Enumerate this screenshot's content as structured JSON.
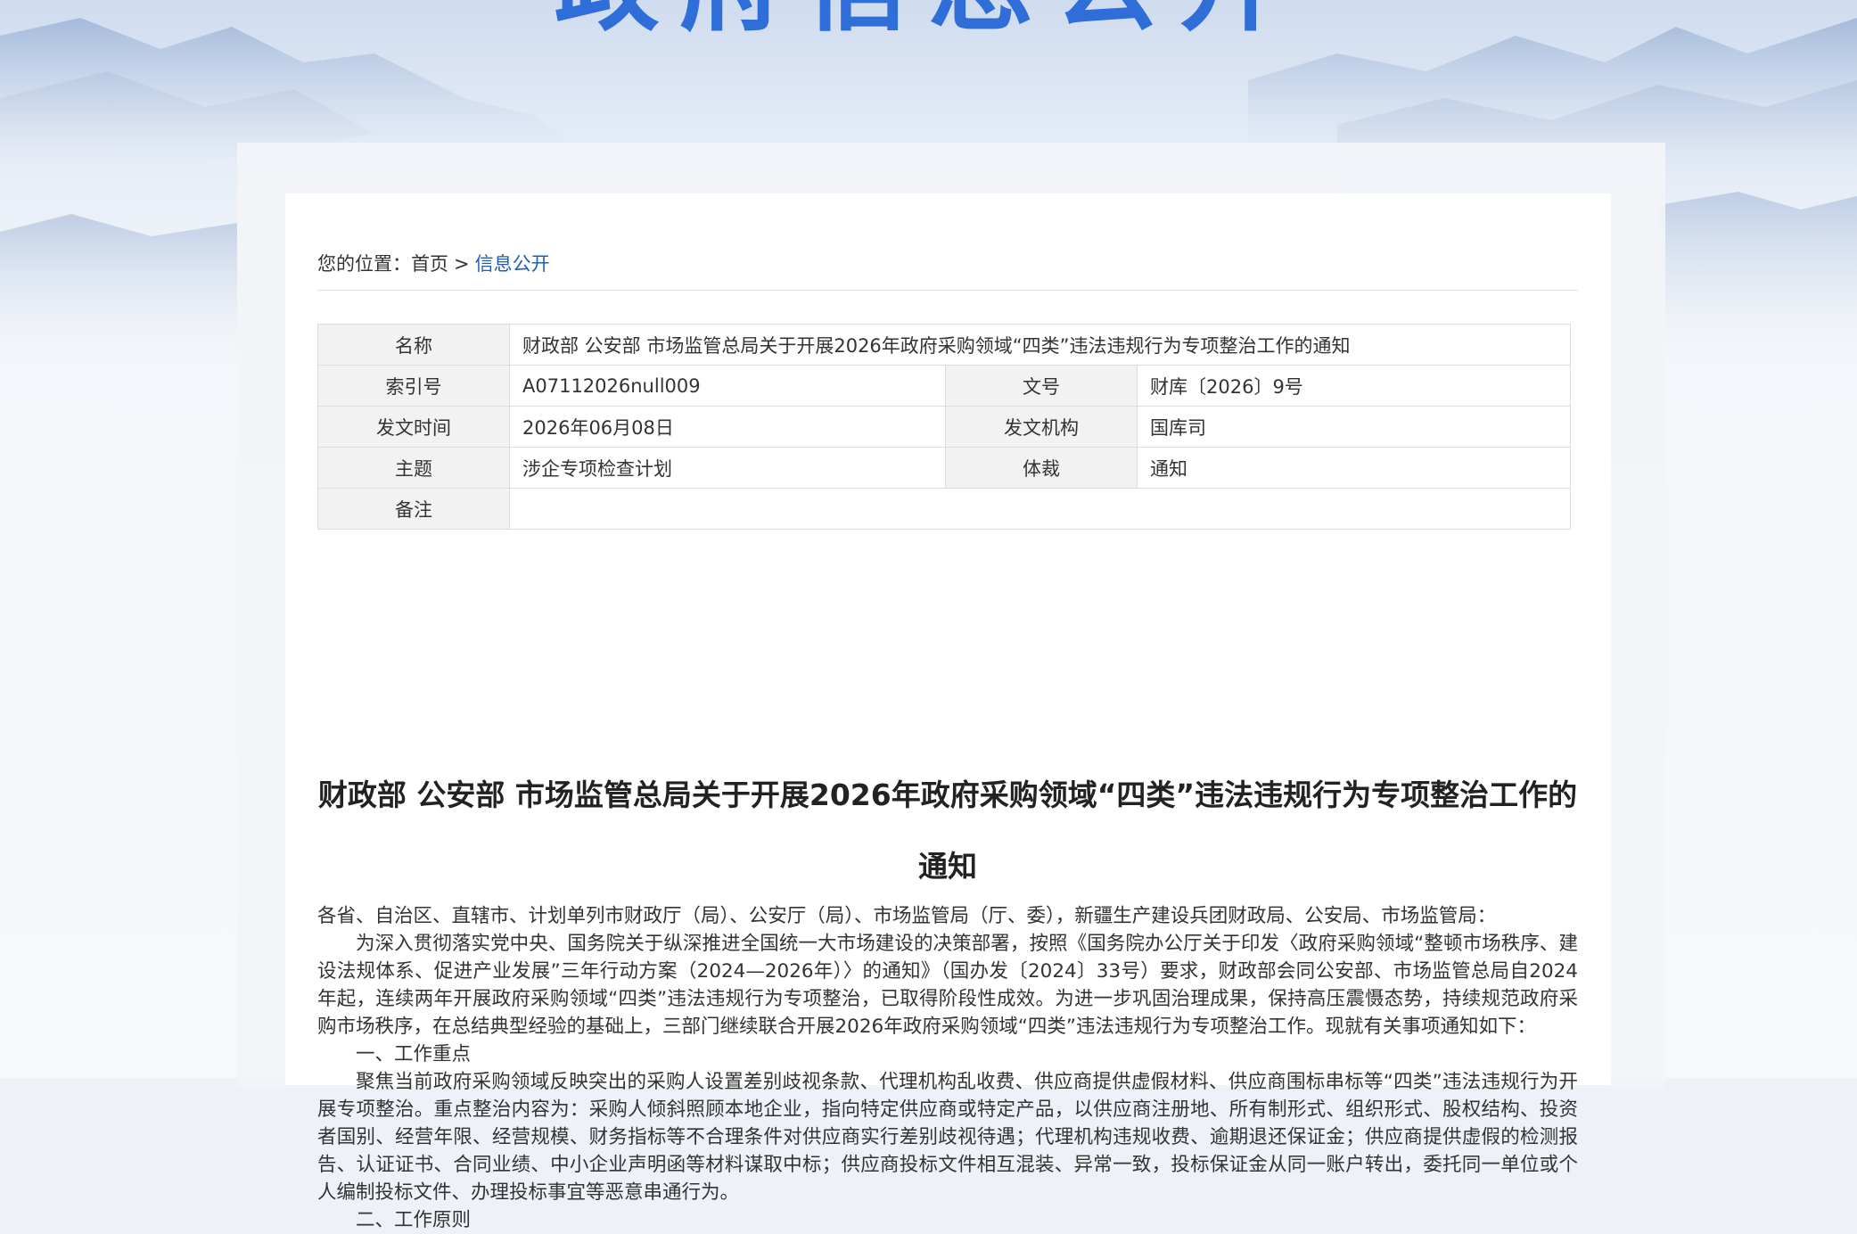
{
  "banner": {
    "title": "政府信息公开"
  },
  "breadcrumb": {
    "prefix": "您的位置：",
    "home": "首页",
    "separator": ">",
    "current": "信息公开"
  },
  "meta": {
    "name_label": "名称",
    "name_value": "财政部 公安部 市场监管总局关于开展2026年政府采购领域“四类”违法违规行为专项整治工作的通知",
    "index_label": "索引号",
    "index_value": "A07112026null009",
    "docno_label": "文号",
    "docno_value": "财库〔2026〕9号",
    "date_label": "发文时间",
    "date_value": "2026年06月08日",
    "org_label": "发文机构",
    "org_value": "国库司",
    "topic_label": "主题",
    "topic_value": "涉企专项检查计划",
    "genre_label": "体裁",
    "genre_value": "通知",
    "note_label": "备注",
    "note_value": ""
  },
  "document": {
    "title": "财政部 公安部 市场监管总局关于开展2026年政府采购领域“四类”违法违规行为专项整治工作的通知",
    "salutation": "各省、自治区、直辖市、计划单列市财政厅（局）、公安厅（局）、市场监管局（厅、委），新疆生产建设兵团财政局、公安局、市场监管局：",
    "para1": "为深入贯彻落实党中央、国务院关于纵深推进全国统一大市场建设的决策部署，按照《国务院办公厅关于印发〈政府采购领域“整顿市场秩序、建设法规体系、促进产业发展”三年行动方案（2024—2026年）〉的通知》（国办发〔2024〕33号）要求，财政部会同公安部、市场监管总局自2024年起，连续两年开展政府采购领域“四类”违法违规行为专项整治，已取得阶段性成效。为进一步巩固治理成果，保持高压震慑态势，持续规范政府采购市场秩序，在总结典型经验的基础上，三部门继续联合开展2026年政府采购领域“四类”违法违规行为专项整治工作。现就有关事项通知如下：",
    "heading1": "一、工作重点",
    "para2": "聚焦当前政府采购领域反映突出的采购人设置差别歧视条款、代理机构乱收费、供应商提供虚假材料、供应商围标串标等“四类”违法违规行为开展专项整治。重点整治内容为：采购人倾斜照顾本地企业，指向特定供应商或特定产品，以供应商注册地、所有制形式、组织形式、股权结构、投资者国别、经营年限、经营规模、财务指标等不合理条件对供应商实行差别歧视待遇；代理机构违规收费、逾期退还保证金；供应商提供虚假的检测报告、认证证书、合同业绩、中小企业声明函等材料谋取中标；供应商投标文件相互混装、异常一致，投标保证金从同一账户转出，委托同一单位或个人编制投标文件、办理投标事宜等恶意串通行为。",
    "heading2": "二、工作原则"
  }
}
